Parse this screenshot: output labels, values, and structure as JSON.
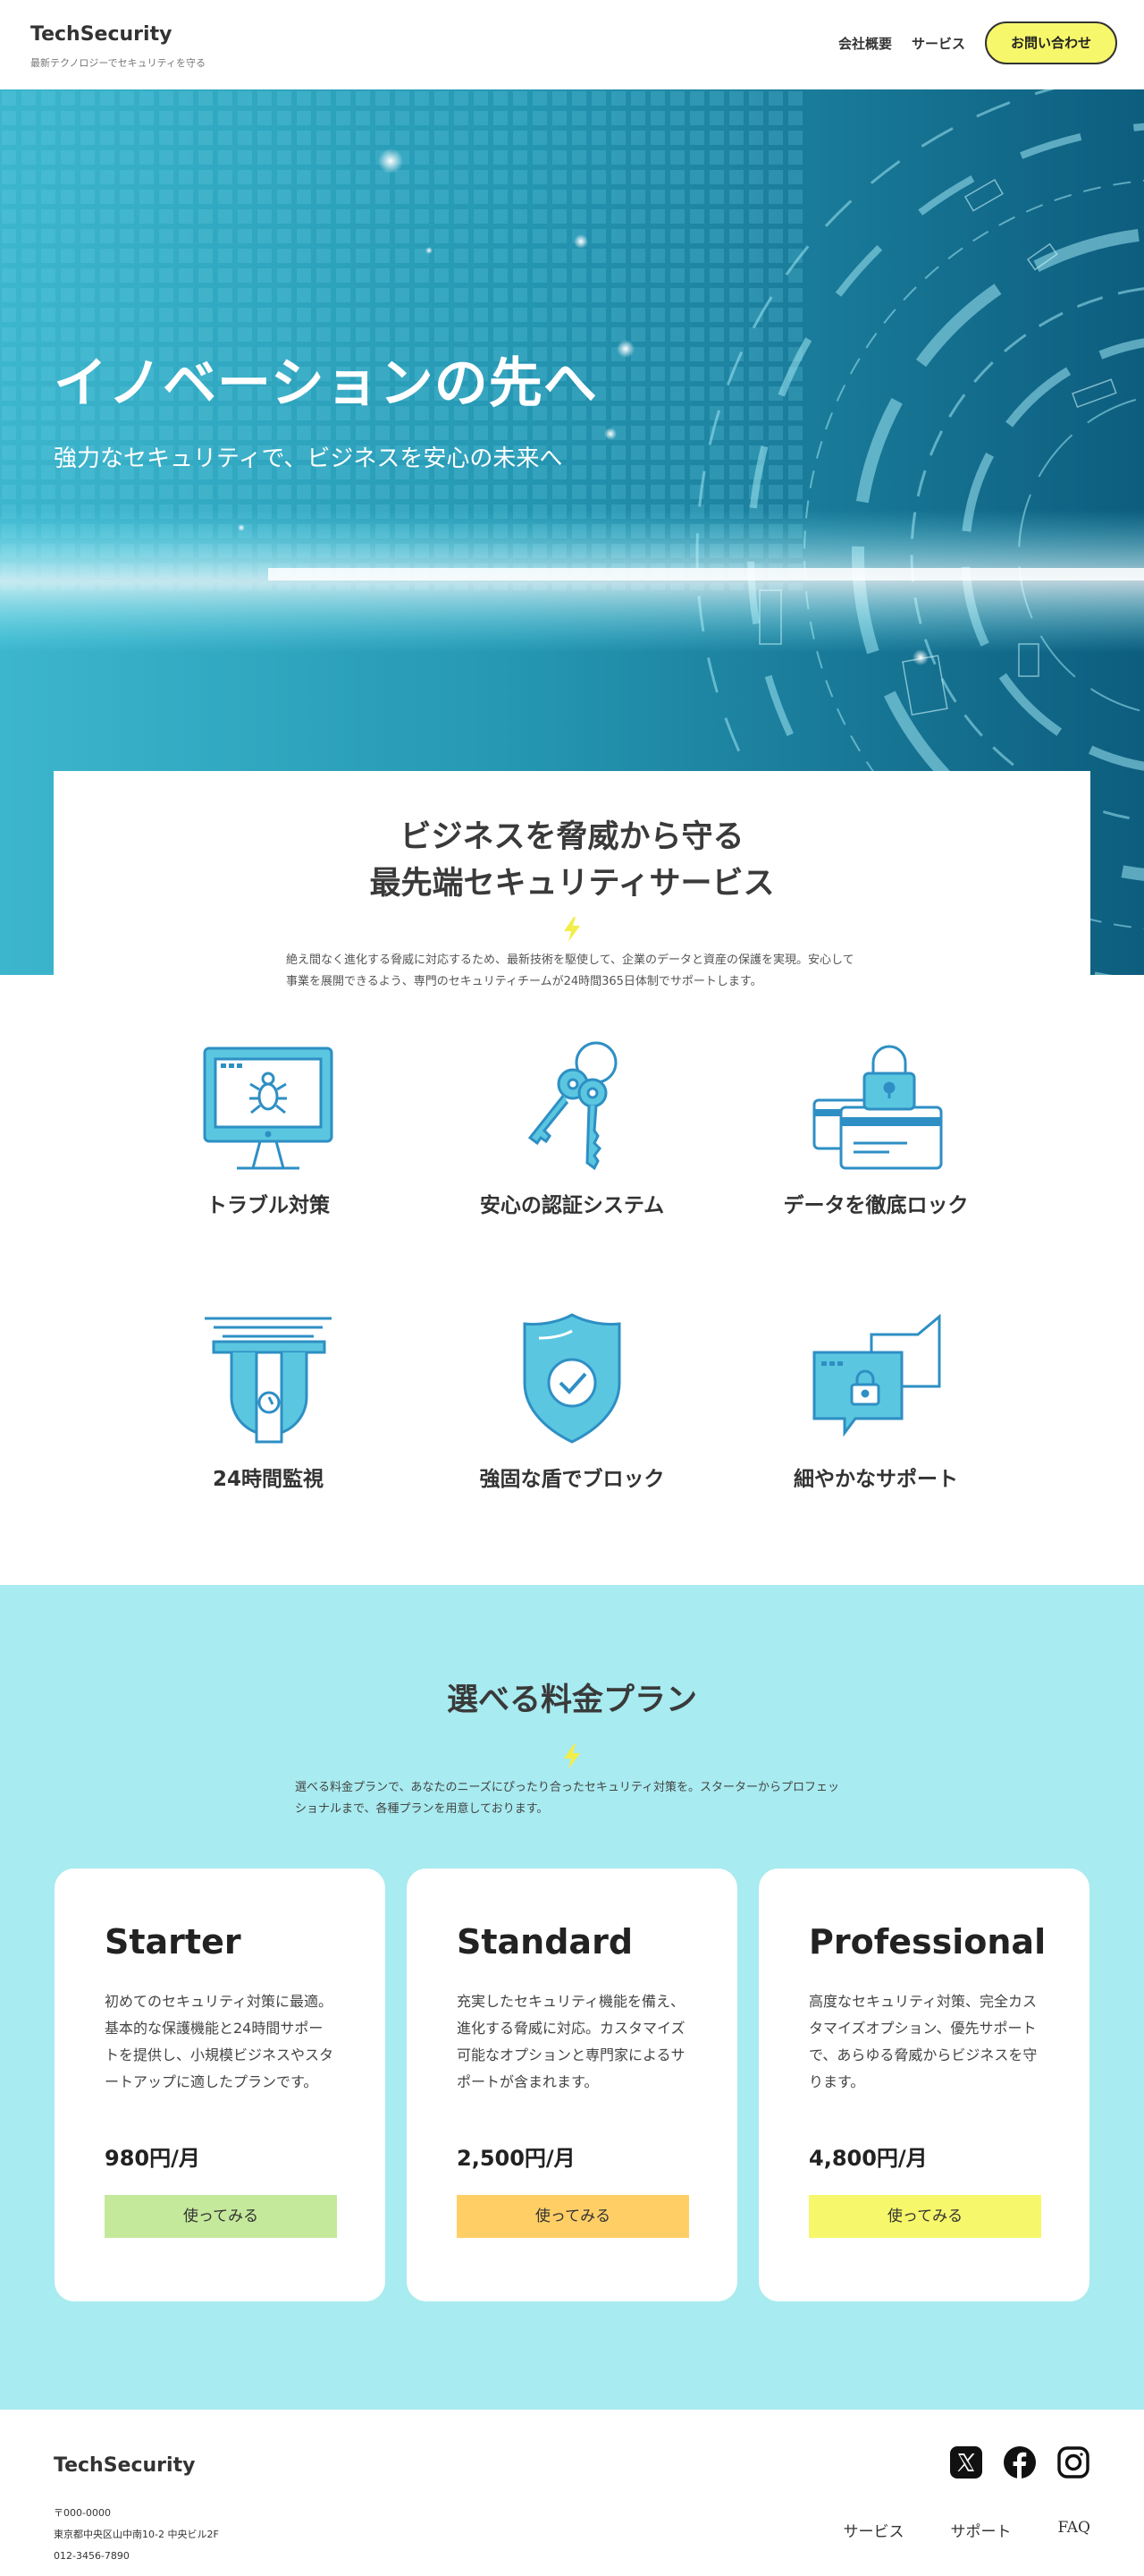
{
  "header": {
    "logo": "TechSecurity",
    "tagline": "最新テクノロジーでセキュリティを守る",
    "nav": [
      "会社概要",
      "サービス"
    ],
    "contact_button": "お問い合わせ"
  },
  "hero": {
    "title": "イノベーションの先へ",
    "subtitle": "強力なセキュリティで、ビジネスを安心の未来へ"
  },
  "services": {
    "heading_line1": "ビジネスを脅威から守る",
    "heading_line2": "最先端セキュリティサービス",
    "intro": "絶え間なく進化する脅威に対応するため、最新技術を駆使して、企業のデータと資産の保護を実現。安心して事業を展開できるよう、専門のセキュリティチームが24時間365日体制でサポートします。",
    "features": [
      {
        "label": "トラブル対策",
        "icon": "monitor-bug-icon"
      },
      {
        "label": "安心の認証システム",
        "icon": "keys-icon"
      },
      {
        "label": "データを徹底ロック",
        "icon": "card-lock-icon"
      },
      {
        "label": "24時間監視",
        "icon": "security-camera-icon"
      },
      {
        "label": "強固な盾でブロック",
        "icon": "shield-check-icon"
      },
      {
        "label": "細やかなサポート",
        "icon": "chat-lock-icon"
      }
    ]
  },
  "pricing": {
    "heading": "選べる料金プラン",
    "intro": "選べる料金プランで、あなたのニーズにぴったり合ったセキュリティ対策を。スターターからプロフェッショナルまで、各種プランを用意しております。",
    "plans": [
      {
        "name": "Starter",
        "description": "初めてのセキュリティ対策に最適。基本的な保護機能と24時間サポートを提供し、小規模ビジネスやスタートアップに適したプランです。",
        "price": "980円/月",
        "button": "使ってみる",
        "button_color": "#c5e99b"
      },
      {
        "name": "Standard",
        "description": "充実したセキュリティ機能を備え、進化する脅威に対応。カスタマイズ可能なオプションと専門家によるサポートが含まれます。",
        "price": "2,500円/月",
        "button": "使ってみる",
        "button_color": "#ffcf66"
      },
      {
        "name": "Professional",
        "description": "高度なセキュリティ対策、完全カスタマイズオプション、優先サポートで、あらゆる脅威からビジネスを守ります。",
        "price": "4,800円/月",
        "button": "使ってみる",
        "button_color": "#f7f76b"
      }
    ]
  },
  "footer": {
    "logo": "TechSecurity",
    "postal": "〒000-0000",
    "address": "東京都中央区山中南10-2 中央ビル2F",
    "phone": "012-3456-7890",
    "socials": [
      "x-icon",
      "facebook-icon",
      "instagram-icon"
    ],
    "links": [
      "サービス",
      "サポート",
      "FAQ"
    ]
  },
  "colors": {
    "accent_yellow": "#f7f76b",
    "pricing_bg": "#a8ebf0",
    "icon_blue": "#2e8fc4",
    "icon_fill": "#5bc6e0",
    "hero_teal": "#1f8aa6"
  }
}
